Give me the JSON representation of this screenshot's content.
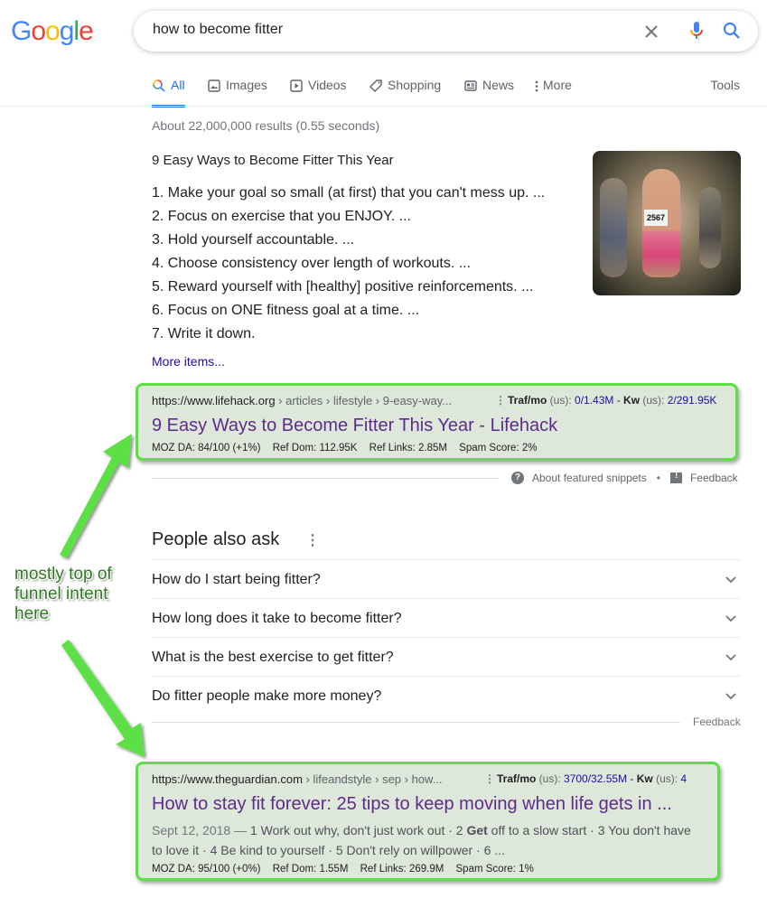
{
  "header": {
    "logo_letters": [
      "G",
      "o",
      "o",
      "g",
      "l",
      "e"
    ],
    "logo_colors": [
      "#4285f4",
      "#ea4335",
      "#fbbc05",
      "#4285f4",
      "#34a853",
      "#ea4335"
    ],
    "search_query": "how to become fitter",
    "icons": {
      "clear": "close-icon",
      "voice": "mic-icon",
      "search": "search-icon"
    }
  },
  "tabs": [
    {
      "label": "All",
      "icon": "search-icon",
      "active": true
    },
    {
      "label": "Images",
      "icon": "image-icon",
      "active": false
    },
    {
      "label": "Videos",
      "icon": "play-icon",
      "active": false
    },
    {
      "label": "Shopping",
      "icon": "tag-icon",
      "active": false
    },
    {
      "label": "News",
      "icon": "news-icon",
      "active": false
    },
    {
      "label": "More",
      "icon": "kebab-icon",
      "active": false
    }
  ],
  "tools_label": "Tools",
  "result_stats": "About 22,000,000 results (0.55 seconds)",
  "featured_snippet": {
    "heading": "9 Easy Ways to Become Fitter This Year",
    "items": [
      "1. Make your goal so small (at first) that you can't mess up. ...",
      "2. Focus on exercise that you ENJOY. ...",
      "3. Hold yourself accountable. ...",
      "4. Choose consistency over length of workouts. ...",
      "5. Reward yourself with [healthy] positive reinforcements. ...",
      "6. Focus on ONE fitness goal at a time. ...",
      "7. Write it down."
    ],
    "image_bib": "2567",
    "more_items": "More items...",
    "about_label": "About featured snippets",
    "feedback_label": "Feedback",
    "separator": "•"
  },
  "results": [
    {
      "url_host": "https://www.lifehack.org",
      "url_path": " › articles › lifestyle › 9-easy-way...",
      "traf_label": "Traf/mo",
      "traf_region": " (us): ",
      "traf_value": "0/1.43M",
      "kw_sep": " - ",
      "kw_label": "Kw",
      "kw_region": " (us): ",
      "kw_value": "2/291.95K",
      "title": "9 Easy Ways to Become Fitter This Year - Lifehack",
      "moz_da": "MOZ DA: 84/100 (+1%)",
      "ref_dom": "Ref Dom: 112.95K",
      "ref_links": "Ref Links: 2.85M",
      "spam_score": "Spam Score: 2%"
    },
    {
      "url_host": "https://www.theguardian.com",
      "url_path": " › lifeandstyle › sep › how...",
      "traf_label": "Traf/mo",
      "traf_region": " (us): ",
      "traf_value": "3700/32.55M",
      "kw_sep": " - ",
      "kw_label": "Kw",
      "kw_region": " (us): ",
      "kw_value": "4",
      "title": "How to stay fit forever: 25 tips to keep moving when life gets in ...",
      "snippet_date": "Sept 12, 2018 — ",
      "snippet_pre": "1 Work out why, don't just work out · 2 ",
      "snippet_bold": "Get",
      "snippet_post": " off to a slow start · 3 You don't have to love it · 4 Be kind to yourself · 5 Don't rely on willpower · 6 ...",
      "moz_da": "MOZ DA: 95/100 (+0%)",
      "ref_dom": "Ref Dom: 1.55M",
      "ref_links": "Ref Links: 269.9M",
      "spam_score": "Spam Score: 1%"
    }
  ],
  "people_also_ask": {
    "title": "People also ask",
    "questions": [
      "How do I start being fitter?",
      "How long does it take to become fitter?",
      "What is the best exercise to get fitter?",
      "Do fitter people make more money?"
    ],
    "feedback_label": "Feedback"
  },
  "annotation": {
    "lines": [
      "mostly top of",
      "funnel intent",
      "here"
    ],
    "color": "#5ce045"
  },
  "colors": {
    "accent": "#1a73e8",
    "link": "#1a0dab",
    "visited_title": "#5f2a8e",
    "highlight_bg": "#dde8da",
    "highlight_border": "#5ce045"
  }
}
